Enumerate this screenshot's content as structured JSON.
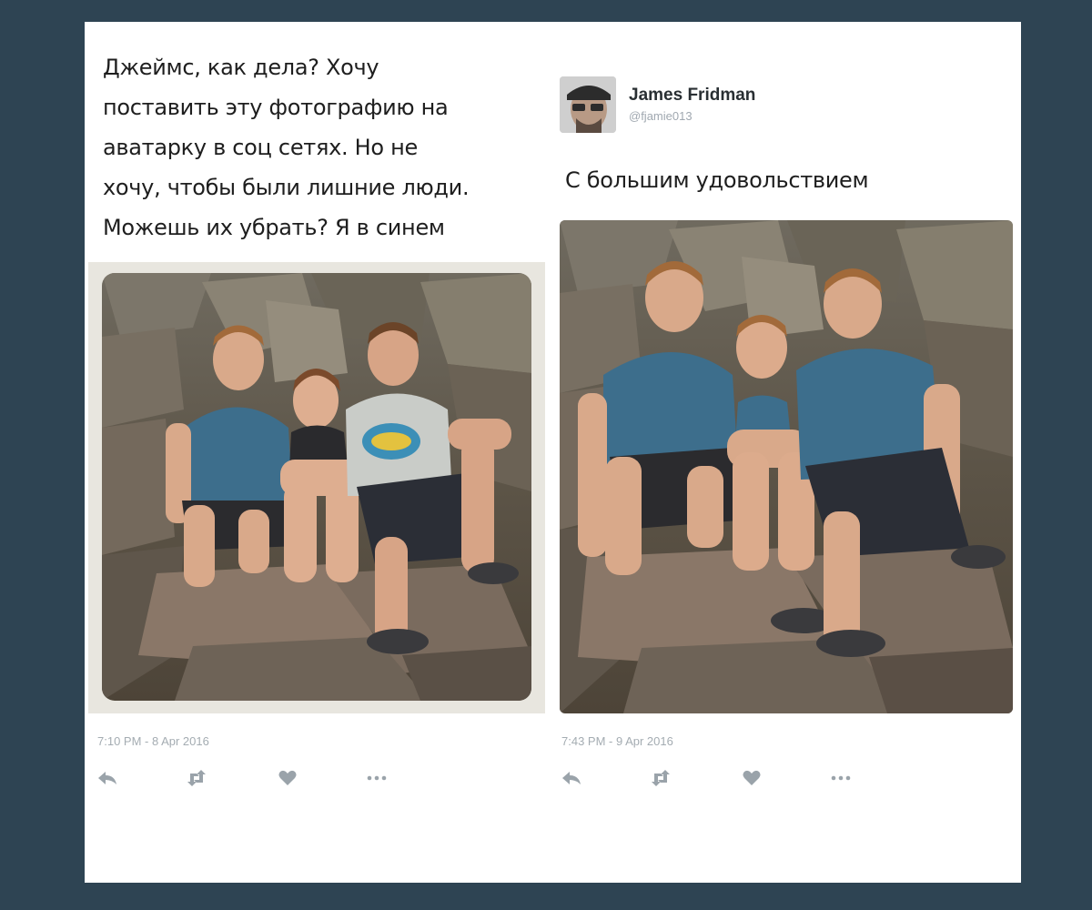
{
  "tweets": {
    "request": {
      "text": "Джеймс, как дела? Хочу\nпоставить эту фотографию на\nаватарку в соц сетях. Но не\nхочу, чтобы были лишние люди.\nМожешь их убрать? Я в синем",
      "timestamp": "7:10 PM - 8 Apr 2016"
    },
    "reply": {
      "author_name": "James Fridman",
      "author_handle": "@fjamie013",
      "text": "С большим удовольствием",
      "timestamp": "7:43 PM - 9 Apr 2016"
    }
  },
  "actions": {
    "reply_icon": "reply-icon",
    "retweet_icon": "retweet-icon",
    "like_icon": "heart-icon",
    "more_icon": "more-icon"
  },
  "colors": {
    "page_background": "#2e4453",
    "card_background": "#ffffff",
    "meta_text": "#a4acb2",
    "icon": "#9aa3aa"
  }
}
